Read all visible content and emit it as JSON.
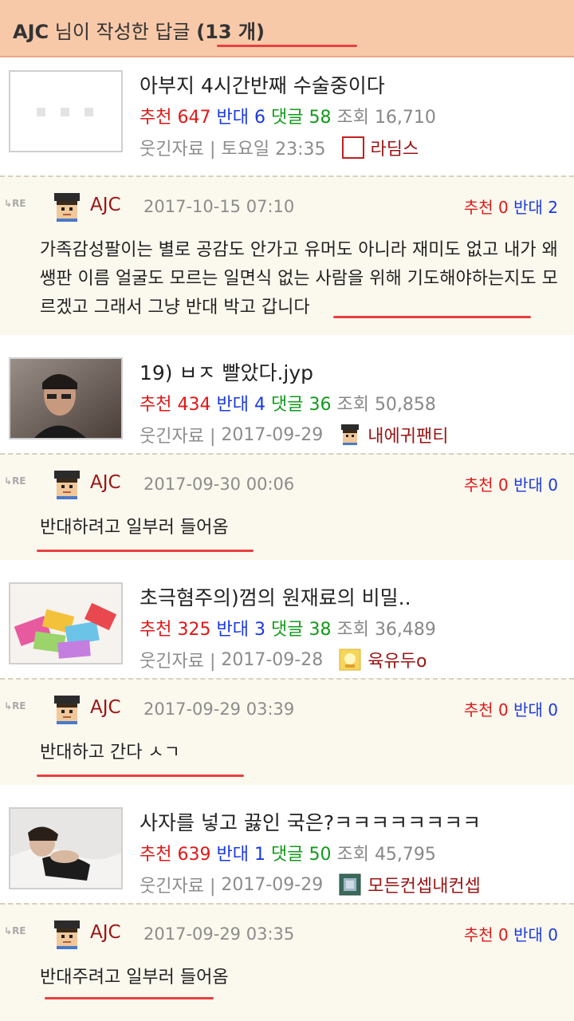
{
  "header": {
    "user": "AJC",
    "text": " 님이 작성한 답글 ",
    "count": "(13 개)"
  },
  "icons": {
    "post-placeholder": "empty-image-placeholder",
    "level": "user-level-icon",
    "re": "reply-re-icon"
  },
  "vote_labels": {
    "up": "추천",
    "down": "반대",
    "comments": "댓글",
    "views": "조회"
  },
  "items": [
    {
      "post": {
        "title": "아부지 4시간반째 수술중이다",
        "up": "647",
        "down": "6",
        "comments": "58",
        "views": "16,710",
        "board": "웃긴자료 |",
        "date": "토요일 23:35",
        "author": "라딤스"
      },
      "reply": {
        "re": "RE",
        "author": "AJC",
        "date": "2017-10-15 07:10",
        "up": "0",
        "down": "2",
        "body": "가족감성팔이는 별로 공감도 안가고 유머도 아니라 재미도 없고 내가 왜 쌩판 이름 얼굴도 모르는 일면식 없는 사람을 위해 기도해야하는지도 모르겠고 그래서 그냥 반대 박고 갑니다"
      }
    },
    {
      "post": {
        "title": "19) ㅂㅈ 빨았다.jyp",
        "up": "434",
        "down": "4",
        "comments": "36",
        "views": "50,858",
        "board": "웃긴자료 |",
        "date": "2017-09-29",
        "author": "내에귀팬티"
      },
      "reply": {
        "re": "RE",
        "author": "AJC",
        "date": "2017-09-30 00:06",
        "up": "0",
        "down": "0",
        "body": "반대하려고 일부러 들어옴"
      }
    },
    {
      "post": {
        "title": "초극혐주의)껌의 원재료의 비밀..",
        "up": "325",
        "down": "3",
        "comments": "38",
        "views": "36,489",
        "board": "웃긴자료 |",
        "date": "2017-09-28",
        "author": "육유두o"
      },
      "reply": {
        "re": "RE",
        "author": "AJC",
        "date": "2017-09-29 03:39",
        "up": "0",
        "down": "0",
        "body": "반대하고 간다 ㅅㄱ"
      }
    },
    {
      "post": {
        "title": "사자를 넣고 끓인 국은?ㅋㅋㅋㅋㅋㅋㅋㅋ",
        "up": "639",
        "down": "1",
        "comments": "50",
        "views": "45,795",
        "board": "웃긴자료 |",
        "date": "2017-09-29",
        "author": "모든컨셉내컨셉"
      },
      "reply": {
        "re": "RE",
        "author": "AJC",
        "date": "2017-09-29 03:35",
        "up": "0",
        "down": "0",
        "body": "반대주려고 일부러 들어옴"
      }
    }
  ]
}
